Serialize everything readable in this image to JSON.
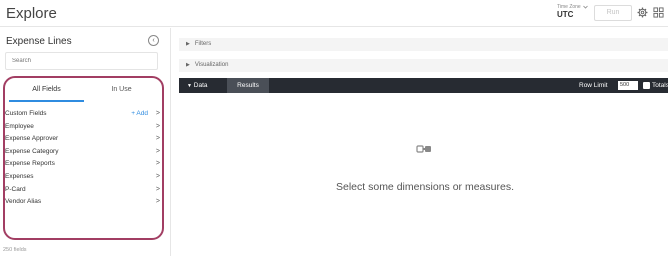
{
  "header": {
    "title": "Explore",
    "timezone_label": "Time Zone",
    "timezone_value": "UTC",
    "run_label": "Run",
    "icons": [
      "gear-icon",
      "grid-icon"
    ]
  },
  "left_panel": {
    "title": "Expense Lines",
    "collapse_icon": "chevron-left-icon",
    "search_placeholder": "Search",
    "tabs": [
      {
        "label": "All Fields",
        "active": true
      },
      {
        "label": "In Use",
        "active": false
      }
    ],
    "fields": [
      {
        "label": "Custom Fields",
        "action": "+ Add"
      },
      {
        "label": "Employee"
      },
      {
        "label": "Expense Approver"
      },
      {
        "label": "Expense Category"
      },
      {
        "label": "Expense Reports"
      },
      {
        "label": "Expenses"
      },
      {
        "label": "P-Card"
      },
      {
        "label": "Vendor Alias"
      }
    ],
    "field_count": "250 fields"
  },
  "right_panel": {
    "filters_label": "Filters",
    "visualization_label": "Visualization",
    "data_label": "Data",
    "results_label": "Results",
    "row_limit_label": "Row Limit",
    "row_limit_value": "500",
    "totals_label": "Totals",
    "empty_message": "Select some dimensions or measures."
  },
  "colors": {
    "accent": "#2f8ce0",
    "highlight_border": "#a23e63",
    "databar": "#272b32"
  }
}
